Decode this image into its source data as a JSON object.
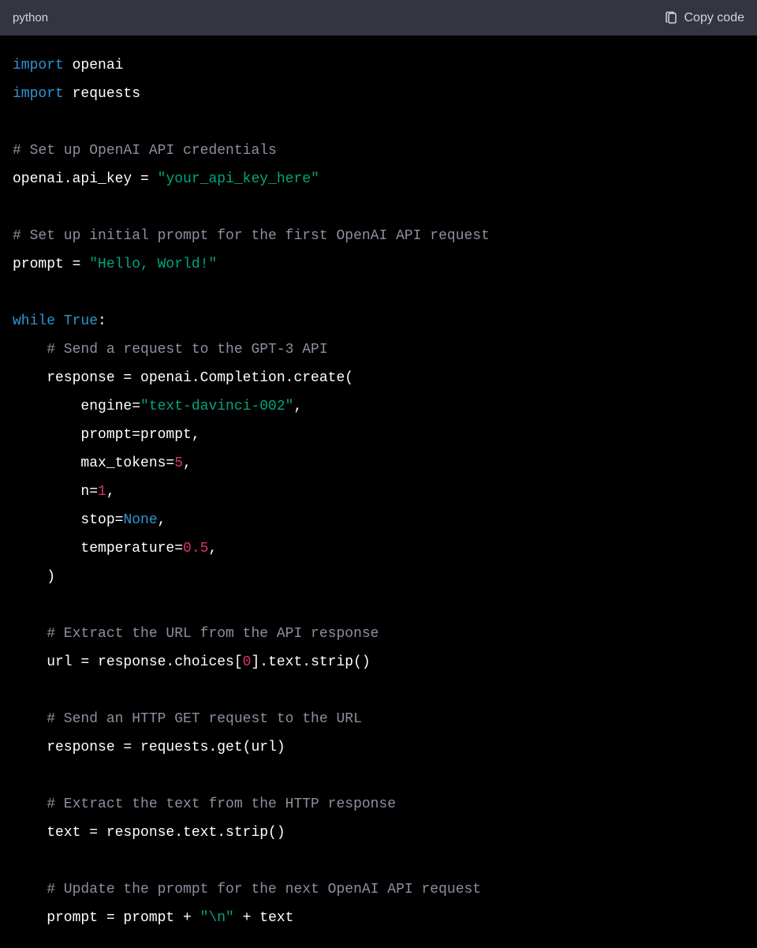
{
  "header": {
    "language": "python",
    "copy_label": "Copy code"
  },
  "code": {
    "l1_import1": "import",
    "l1_mod1": " openai",
    "l2_import": "import",
    "l2_mod": " requests",
    "l4_com": "# Set up OpenAI API credentials",
    "l5_a": "openai.api_key = ",
    "l5_str": "\"your_api_key_here\"",
    "l7_com": "# Set up initial prompt for the first OpenAI API request",
    "l8_a": "prompt = ",
    "l8_str": "\"Hello, World!\"",
    "l10_while": "while",
    "l10_true": " True",
    "l10_colon": ":",
    "l11_com": "    # Send a request to the GPT-3 API",
    "l12": "    response = openai.Completion.create(",
    "l13_a": "        engine=",
    "l13_str": "\"text-davinci-002\"",
    "l13_c": ",",
    "l14": "        prompt=prompt,",
    "l15_a": "        max_tokens=",
    "l15_num": "5",
    "l15_c": ",",
    "l16_a": "        n=",
    "l16_num": "1",
    "l16_c": ",",
    "l17_a": "        stop=",
    "l17_none": "None",
    "l17_c": ",",
    "l18_a": "        temperature=",
    "l18_num": "0.5",
    "l18_c": ",",
    "l19": "    )",
    "l21_com": "    # Extract the URL from the API response",
    "l22_a": "    url = response.choices[",
    "l22_num": "0",
    "l22_b": "].text.strip()",
    "l24_com": "    # Send an HTTP GET request to the URL",
    "l25": "    response = requests.get(url)",
    "l27_com": "    # Extract the text from the HTTP response",
    "l28": "    text = response.text.strip()",
    "l30_com": "    # Update the prompt for the next OpenAI API request",
    "l31_a": "    prompt = prompt + ",
    "l31_str1": "\"\\n\"",
    "l31_b": " + text"
  }
}
